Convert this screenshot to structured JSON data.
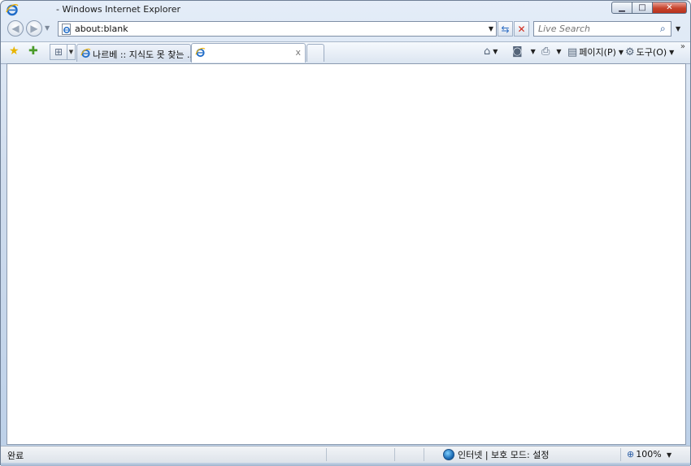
{
  "window": {
    "title": "- Windows Internet Explorer",
    "controls": {
      "minimize": "▁",
      "maximize": "□",
      "close": "✕"
    }
  },
  "nav": {
    "back_glyph": "◀",
    "forward_glyph": "▶",
    "dropdown_glyph": "▼",
    "address": "about:blank",
    "refresh_glyph": "⇆",
    "stop_glyph": "✕",
    "search_placeholder": "Live Search",
    "search_glyph": "⌕"
  },
  "tabs": {
    "favorites_glyph": "★",
    "add_favorites_glyph": "✚",
    "quicktabs_glyph": "⊞",
    "tablist_glyph": "▼",
    "items": [
      {
        "label": "나르베 :: 지식도 못 찾는 ...",
        "active": false
      },
      {
        "label": "",
        "active": true,
        "close_glyph": "x"
      }
    ]
  },
  "commandbar": {
    "home_glyph": "⌂",
    "feeds_glyph": "◙",
    "print_glyph": "⎙",
    "dropdown_glyph": "▼",
    "page_label": "페이지(P)",
    "page_glyph": "▤",
    "tools_label": "도구(O)",
    "tools_glyph": "⚙",
    "chevron": "»"
  },
  "status": {
    "text": "완료",
    "zone": "인터넷 | 보호 모드: 설정",
    "zoom": "100%",
    "zoom_glyph": "⊕",
    "zoom_dropdown": "▼"
  },
  "colors": {
    "frame": "#cfdced",
    "close_button": "#c7432c",
    "accent": "#2f6fc4"
  }
}
